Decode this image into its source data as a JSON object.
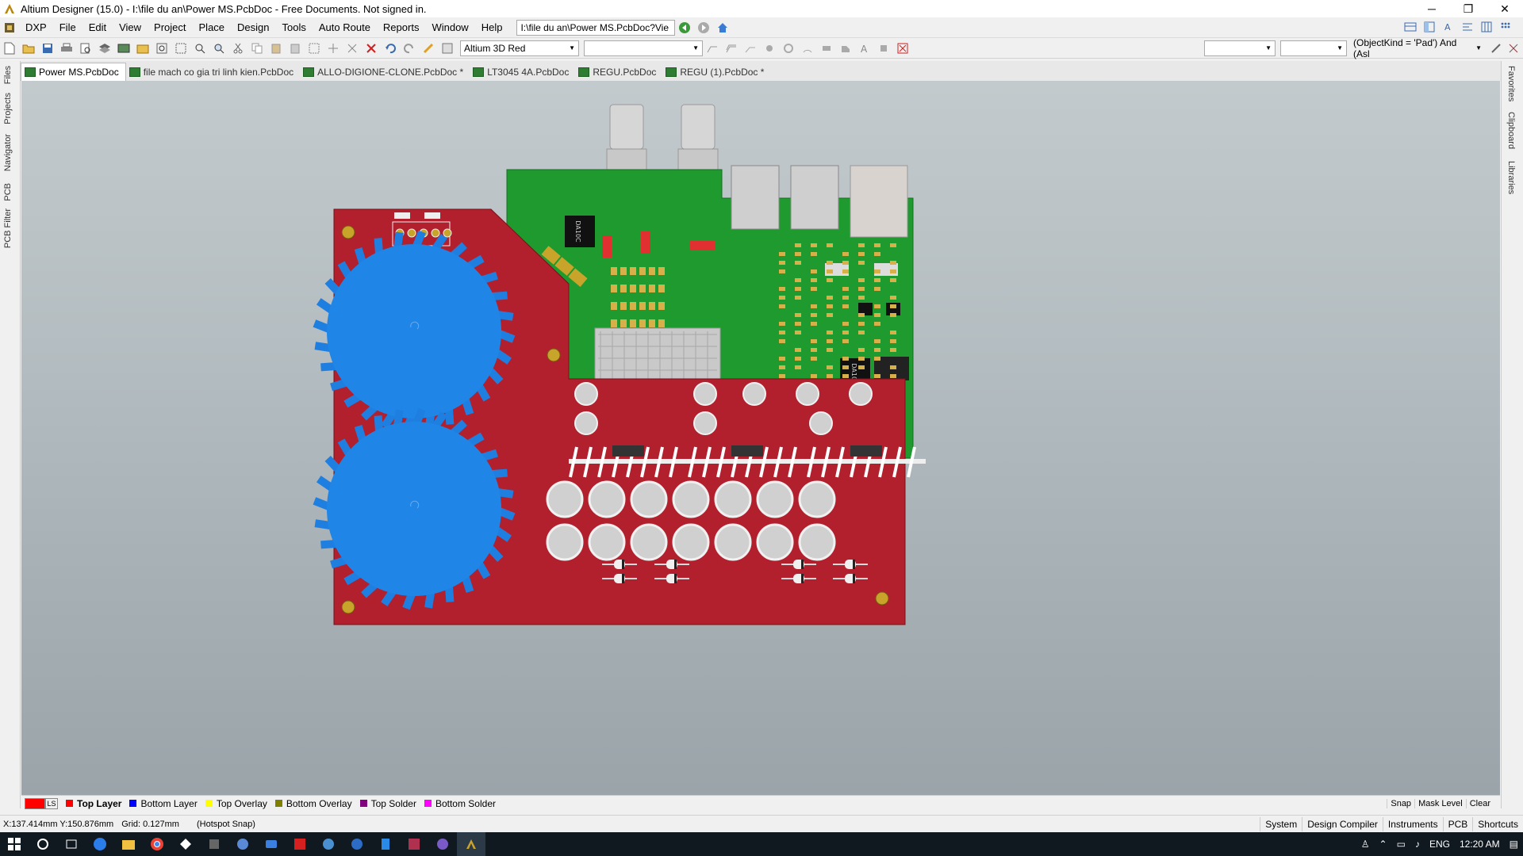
{
  "window": {
    "title": "Altium Designer (15.0) - I:\\file du an\\Power MS.PcbDoc - Free Documents. Not signed in.",
    "minimize": "─",
    "maximize": "❐",
    "close": "✕"
  },
  "menu": {
    "items": [
      "DXP",
      "File",
      "Edit",
      "View",
      "Project",
      "Place",
      "Design",
      "Tools",
      "Auto Route",
      "Reports",
      "Window",
      "Help"
    ],
    "address": "I:\\file du an\\Power MS.PcbDoc?Vie"
  },
  "toolbar": {
    "view_config": "Altium 3D Red",
    "filter_query": "(ObjectKind = 'Pad') And (Asl"
  },
  "tabs": [
    {
      "label": "Power MS.PcbDoc",
      "active": true
    },
    {
      "label": "file mach co gia tri linh kien.PcbDoc",
      "active": false
    },
    {
      "label": "ALLO-DIGIONE-CLONE.PcbDoc *",
      "active": false
    },
    {
      "label": "LT3045 4A.PcbDoc",
      "active": false
    },
    {
      "label": "REGU.PcbDoc",
      "active": false
    },
    {
      "label": "REGU (1).PcbDoc *",
      "active": false
    }
  ],
  "left_panels": [
    "Files",
    "Projects",
    "Navigator",
    "PCB",
    "PCB Filter"
  ],
  "right_panels": [
    "Favorites",
    "Clipboard",
    "Libraries"
  ],
  "layers": {
    "ls_label": "LS",
    "items": [
      {
        "label": "Top Layer",
        "color": "#ff0000",
        "active": true
      },
      {
        "label": "Bottom Layer",
        "color": "#0000ff",
        "active": false
      },
      {
        "label": "Top Overlay",
        "color": "#ffff00",
        "active": false
      },
      {
        "label": "Bottom Overlay",
        "color": "#808000",
        "active": false
      },
      {
        "label": "Top Solder",
        "color": "#800080",
        "active": false
      },
      {
        "label": "Bottom Solder",
        "color": "#ff00ff",
        "active": false
      }
    ],
    "right": [
      "Snap",
      "Mask Level",
      "Clear"
    ]
  },
  "status": {
    "coords": "X:137.414mm Y:150.876mm",
    "grid": "Grid: 0.127mm",
    "snap": "(Hotspot Snap)",
    "buttons": [
      "System",
      "Design Compiler",
      "Instruments",
      "PCB",
      "Shortcuts"
    ]
  },
  "pcb": {
    "chip_label_1": "DA10C",
    "chip_label_2": "DA10C"
  },
  "taskbar": {
    "lang": "ENG",
    "time": "12:20 AM"
  }
}
